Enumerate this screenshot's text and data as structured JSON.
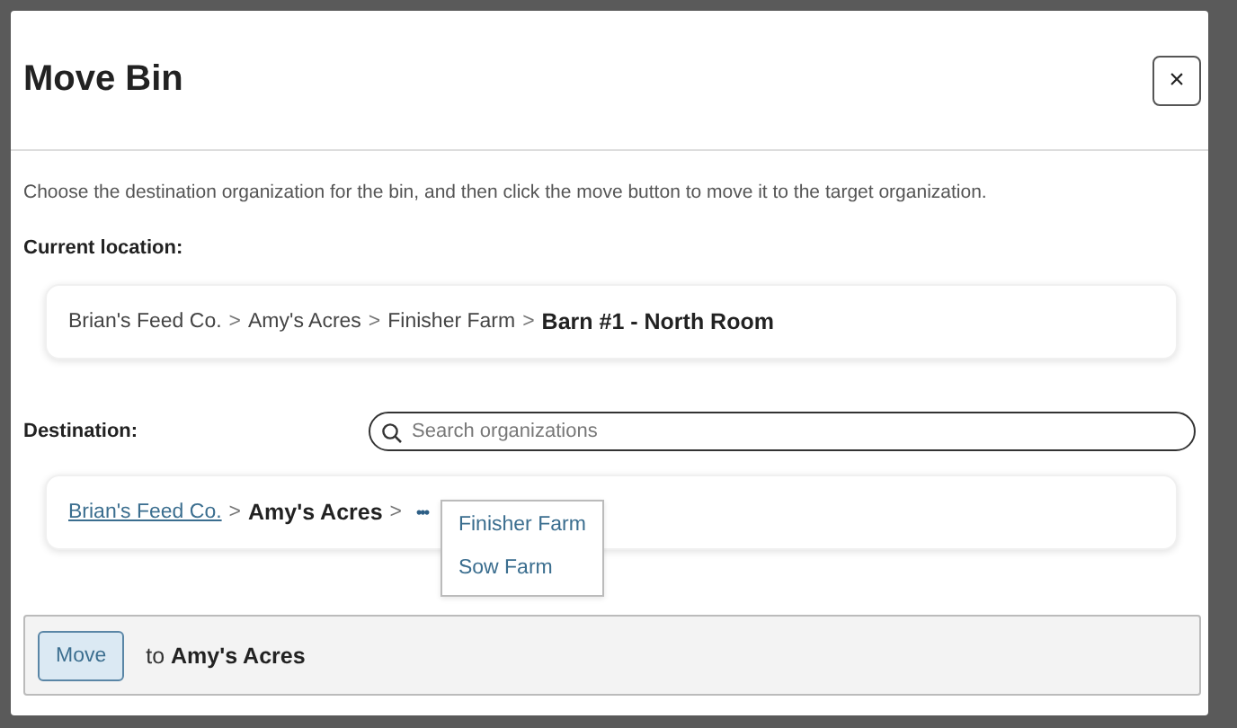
{
  "dialog": {
    "title": "Move Bin",
    "close": "×",
    "description": "Choose the destination organization for the bin, and then click the move button to move it to the target organization.",
    "current_location": {
      "label": "Current location:",
      "path": [
        {
          "kind": "plain",
          "text": "Brian's Feed Co."
        },
        {
          "kind": "separator",
          "text": ">"
        },
        {
          "kind": "plain",
          "text": "Amy's Acres"
        },
        {
          "kind": "separator",
          "text": ">"
        },
        {
          "kind": "plain",
          "text": "Finisher Farm"
        },
        {
          "kind": "separator",
          "text": ">"
        },
        {
          "kind": "current",
          "text": "Barn #1 - North Room"
        }
      ]
    },
    "destination": {
      "label": "Destination:",
      "search": {
        "placeholder": "Search organizations"
      },
      "path": [
        {
          "kind": "link",
          "text": "Brian's Feed Co."
        },
        {
          "kind": "separator",
          "text": ">"
        },
        {
          "kind": "current",
          "text": "Amy's Acres"
        },
        {
          "kind": "separator",
          "text": ">"
        },
        {
          "kind": "more",
          "text": "•••",
          "expanded": true,
          "menu": [
            "Finisher Farm",
            "Sow Farm"
          ]
        }
      ]
    },
    "footer": {
      "button": "Move",
      "summary": "to **Amy's Acres**"
    }
  }
}
